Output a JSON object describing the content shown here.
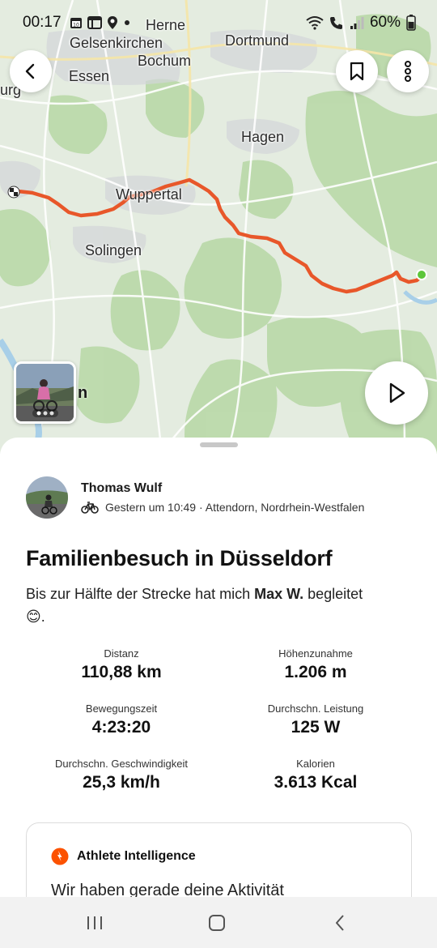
{
  "status_bar": {
    "time": "00:17",
    "battery": "60%",
    "icons": [
      "calendar-icon",
      "gallery-icon",
      "location-icon",
      "dot-icon",
      "wifi-icon",
      "call-icon",
      "signal-icon",
      "battery-icon"
    ]
  },
  "map": {
    "places": [
      {
        "id": "herne",
        "label": "Herne"
      },
      {
        "id": "gelsenkirchen",
        "label": "Gelsenkirchen"
      },
      {
        "id": "dortmund",
        "label": "Dortmund"
      },
      {
        "id": "bochum",
        "label": "Bochum"
      },
      {
        "id": "essen",
        "label": "Essen"
      },
      {
        "id": "urg",
        "label": "urg"
      },
      {
        "id": "hagen",
        "label": "Hagen"
      },
      {
        "id": "wuppertal",
        "label": "Wuppertal"
      },
      {
        "id": "solingen",
        "label": "Solingen"
      }
    ],
    "route_color": "#e8572a",
    "start_marker_color": "#5cc63a",
    "photo_suffix": "n",
    "photo_count_dots": 3,
    "buttons": {
      "back": "back-icon",
      "bookmark": "bookmark-icon",
      "more": "more-vertical-icon",
      "play": "play-icon"
    }
  },
  "activity": {
    "athlete_name": "Thomas Wulf",
    "meta": "Gestern um 10:49 · Attendorn, Nordrhein-Westfalen",
    "sport_icon": "bike-icon",
    "title": "Familienbesuch in Düsseldorf",
    "description_pre": "Bis zur Hälfte der Strecke hat mich ",
    "description_bold": "Max W.",
    "description_post": " begleitet",
    "description_emoji": "😊",
    "description_end": ".",
    "stats": [
      {
        "label": "Distanz",
        "value": "110,88 km"
      },
      {
        "label": "Höhenzunahme",
        "value": "1.206 m"
      },
      {
        "label": "Bewegungszeit",
        "value": "4:23:20"
      },
      {
        "label": "Durchschn. Leistung",
        "value": "125 W"
      },
      {
        "label": "Durchschn. Geschwindigkeit",
        "value": "25,3 km/h"
      },
      {
        "label": "Kalorien",
        "value": "3.613 Kcal"
      }
    ]
  },
  "ai_card": {
    "title": "Athlete Intelligence",
    "text": "Wir haben gerade deine Aktivität",
    "accent": "#fc5200"
  },
  "nav_bar": {
    "buttons": [
      "recents-icon",
      "home-icon",
      "back-nav-icon"
    ]
  }
}
